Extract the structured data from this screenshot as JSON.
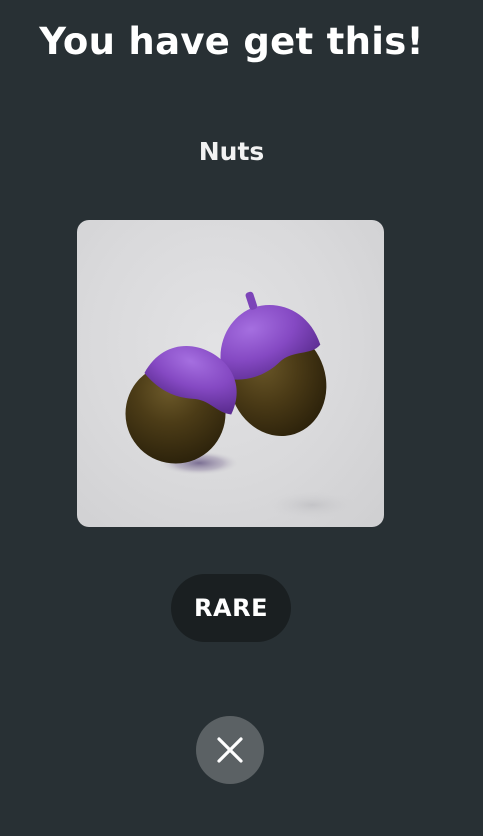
{
  "dialog": {
    "title": "You have get this!",
    "item_name": "Nuts",
    "rarity": "RARE",
    "item_image": "acorns-image",
    "close_icon": "close-icon"
  },
  "colors": {
    "background": "#283034",
    "card_background": "#dcdcde",
    "badge_background": "#1a1f21",
    "close_button_background": "#5b6164",
    "acorn_cap": "#8a4fc4",
    "acorn_body": "#4a3b17",
    "text": "#ffffff"
  }
}
